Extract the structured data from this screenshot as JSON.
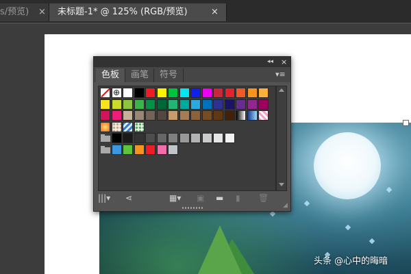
{
  "document_tabs": [
    {
      "label": "s/预览)",
      "close": "×",
      "active": false
    },
    {
      "label": "未标题-1* @ 125% (RGB/预览)",
      "close": "×",
      "active": true
    }
  ],
  "panel": {
    "collapse_glyph": "◂◂",
    "close_glyph": "×",
    "menu_glyph": "▾≡",
    "tabs": [
      {
        "label": "色板",
        "active": true
      },
      {
        "label": "画笔",
        "active": false
      },
      {
        "label": "符号",
        "active": false
      }
    ],
    "swatch_rows": [
      [
        "none",
        "registration",
        "#ffffff",
        "#000000",
        "#ee1c24",
        "#fff200",
        "#00c33b",
        "#00e5ee",
        "#1220ec",
        "#ed00f2",
        "#c6283c",
        "#e0232c",
        "#f15a24",
        "#f7941d",
        "#fbb03b"
      ],
      [
        "#f9e31d",
        "#cbdb2a",
        "#8cc63f",
        "#39b54a",
        "#009245",
        "#006837",
        "#22b573",
        "#00a99d",
        "#29abe2",
        "#0071bc",
        "#2e3192",
        "#1b1464",
        "#662d91",
        "#93278f",
        "#9e005d"
      ],
      [
        "#d4145a",
        "#ed1e79",
        "#c7b299",
        "#998675",
        "#736357",
        "#534741",
        "#c69c6d",
        "#a67c52",
        "#8c6239",
        "#754c24",
        "#603813",
        "#42210b",
        "gradient-gray",
        "gradient-blue",
        "pattern-pink"
      ],
      [
        "gradient-orange",
        "pattern-dots",
        "pattern-blue",
        "pattern-green"
      ],
      [
        "folder",
        "#000000",
        "#1a1a1a",
        "#333333",
        "#4d4d4d",
        "#666666",
        "#808080",
        "#999999",
        "#b3b3b3",
        "#cccccc",
        "#e6e6e6",
        "#f2f2f2"
      ],
      [
        "folder",
        "#3b97de",
        "#5fc33c",
        "#f7941d",
        "#ee1c24",
        "#f06eaa",
        "#c0c4cb"
      ]
    ],
    "bottom_icons": [
      {
        "name": "swatch-libraries-icon",
        "glyph": "|||▾",
        "enabled": true
      },
      {
        "name": "share-icon",
        "glyph": "⋖",
        "enabled": true
      },
      {
        "name": "show-kinds-icon",
        "glyph": "▦▾",
        "enabled": true
      },
      {
        "name": "swatch-options-icon",
        "glyph": "▣",
        "enabled": false
      },
      {
        "name": "new-group-icon",
        "glyph": "▬",
        "enabled": true
      },
      {
        "name": "new-swatch-icon",
        "glyph": "▮",
        "enabled": false
      },
      {
        "name": "trash-icon",
        "glyph": "🗑",
        "enabled": false
      }
    ]
  },
  "watermark": "头条 @心中的晦暗"
}
